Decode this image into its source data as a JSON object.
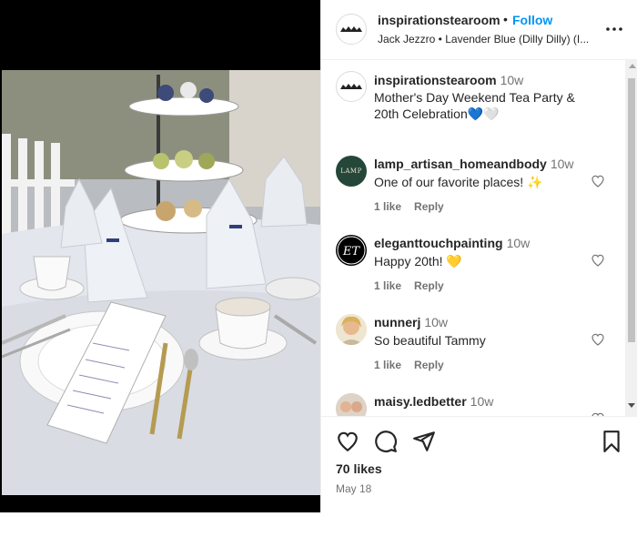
{
  "post": {
    "author": "inspirationstearoom",
    "follow_label": "Follow",
    "separator": "•",
    "audio": "Jack Jezzro • Lavender Blue (Dilly Dilly) (I...",
    "menu_icon": "more-horizontal-icon"
  },
  "caption": {
    "author": "inspirationstearoom",
    "time": "10w",
    "text": "Mother's Day Weekend Tea Party & 20th Celebration💙🤍"
  },
  "comments": [
    {
      "user": "lamp_artisan_homeandbody",
      "time": "10w",
      "text": "One of our favorite places! ✨",
      "likes": "1 like",
      "reply": "Reply",
      "avatar_text": "LAMP"
    },
    {
      "user": "eleganttouchpainting",
      "time": "10w",
      "text": "Happy 20th! 💛",
      "likes": "1 like",
      "reply": "Reply",
      "avatar_text": "ET"
    },
    {
      "user": "nunnerj",
      "time": "10w",
      "text": "So beautiful Tammy",
      "likes": "1 like",
      "reply": "Reply"
    },
    {
      "user": "maisy.ledbetter",
      "time": "10w",
      "text": ""
    }
  ],
  "footer": {
    "likes": "70 likes",
    "date": "May 18"
  },
  "colors": {
    "follow": "#0095f6",
    "secondary_text": "#737373"
  }
}
